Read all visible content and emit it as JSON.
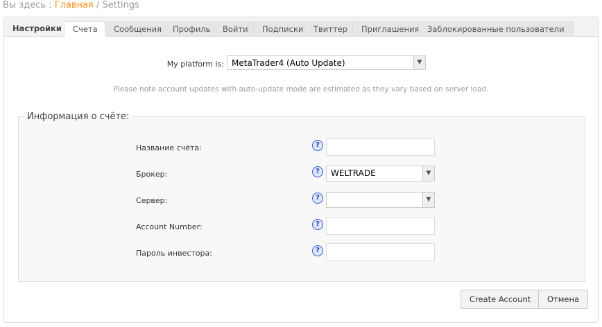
{
  "breadcrumb": {
    "prefix": "Вы здесь :",
    "home": "Главная",
    "sep": "/",
    "current": "Settings"
  },
  "tabs": [
    "Настройки",
    "Счета",
    "Сообщения",
    "Профиль",
    "Войти",
    "Подписки",
    "Твиттер",
    "Приглашения",
    "Заблокированные пользователи"
  ],
  "platform": {
    "label": "My platform is:",
    "value": "MetaTrader4 (Auto Update)"
  },
  "note": "Please note account updates with auto-update mode are estimated as they vary based on server load.",
  "account": {
    "legend": "Информация о счёте:",
    "fields": [
      {
        "label": "Название счёта:",
        "type": "text",
        "value": ""
      },
      {
        "label": "Брокер:",
        "type": "select",
        "value": "WELTRADE"
      },
      {
        "label": "Сервер:",
        "type": "select",
        "value": ""
      },
      {
        "label": "Account Number:",
        "type": "text",
        "value": ""
      },
      {
        "label": "Пароль инвестора:",
        "type": "text",
        "value": ""
      }
    ]
  },
  "buttons": {
    "create": "Create Account",
    "cancel": "Отмена"
  },
  "colors": {
    "accent": "#f7931e",
    "help": "#3a5bc7"
  }
}
